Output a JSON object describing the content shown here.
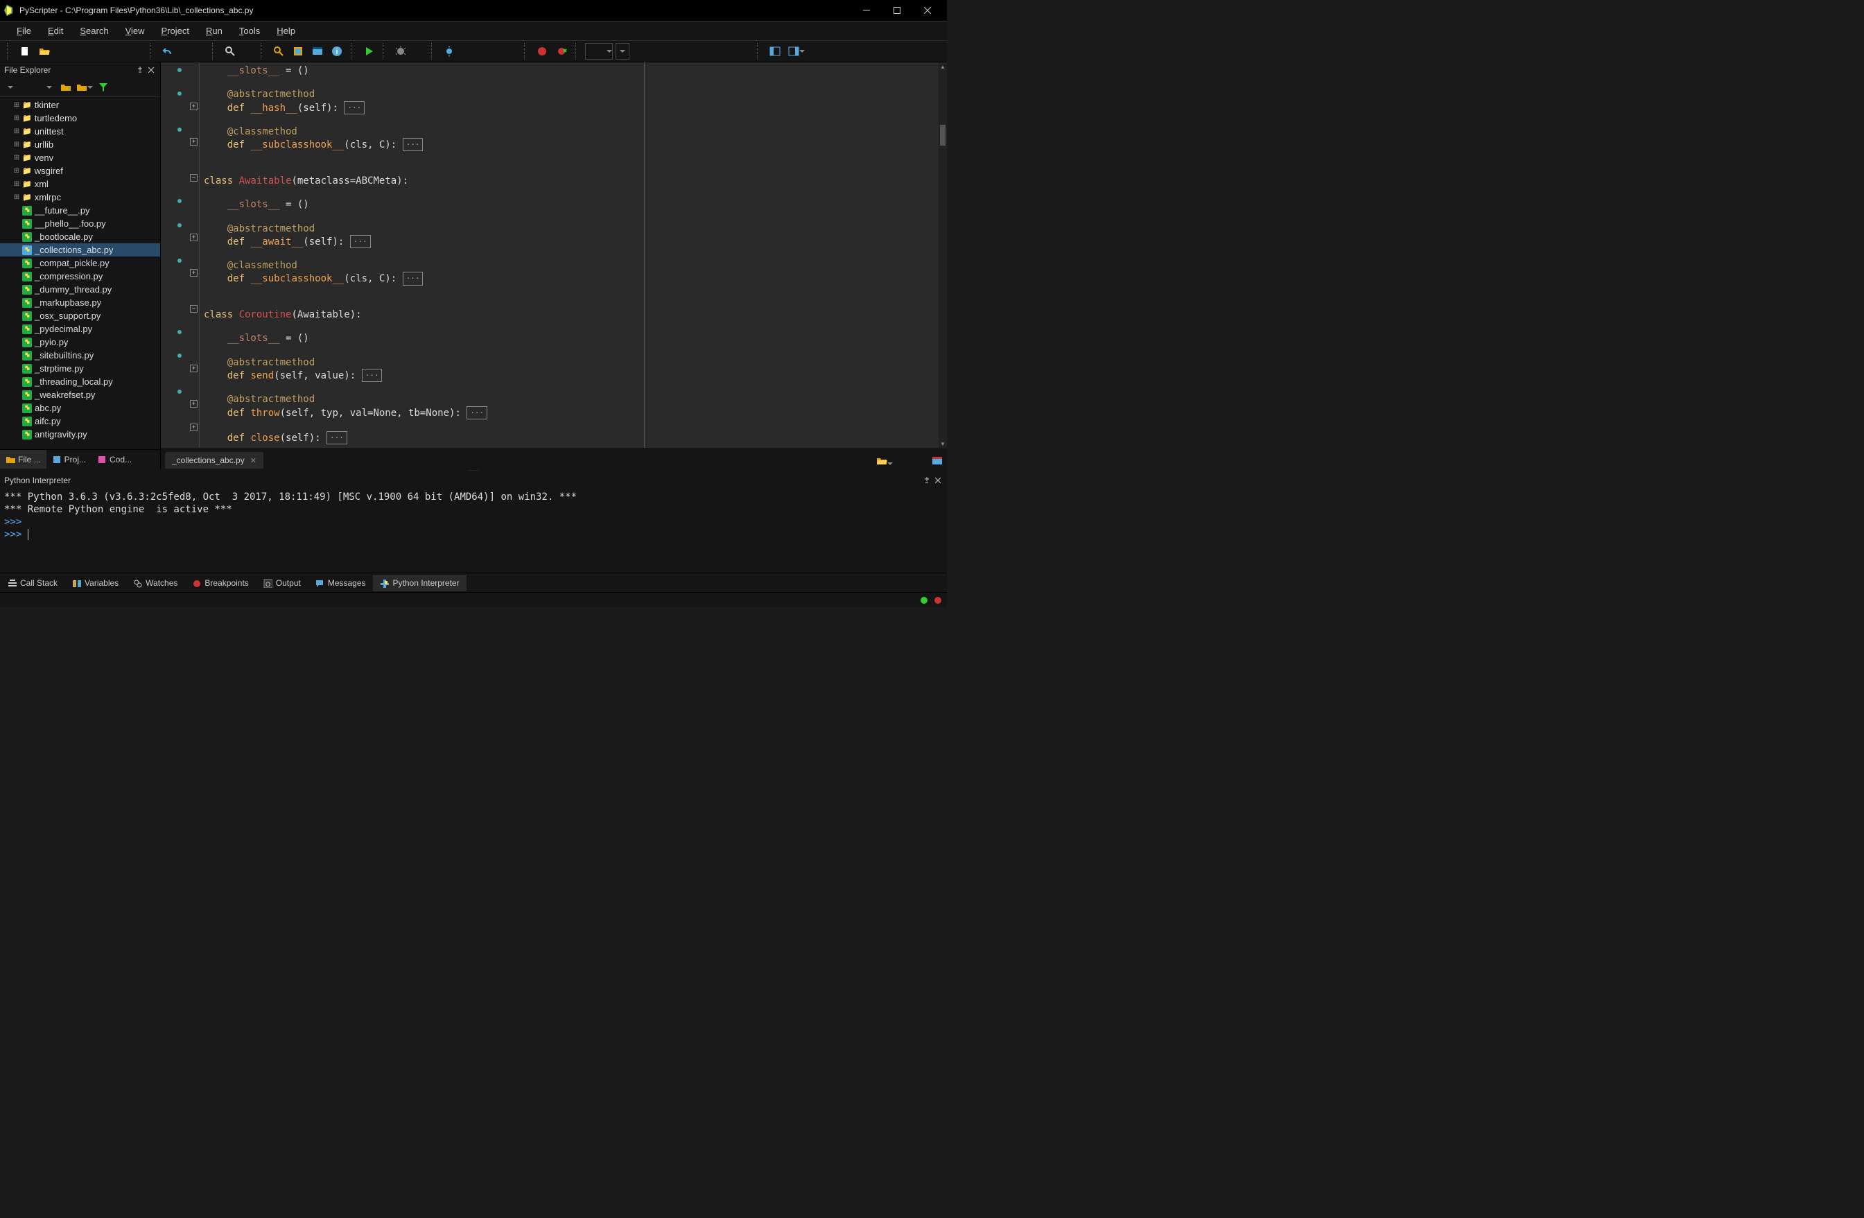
{
  "title": "PyScripter - C:\\Program Files\\Python36\\Lib\\_collections_abc.py",
  "menu": [
    "File",
    "Edit",
    "Search",
    "View",
    "Project",
    "Run",
    "Tools",
    "Help"
  ],
  "sidebar": {
    "title": "File Explorer",
    "folders": [
      "tkinter",
      "turtledemo",
      "unittest",
      "urllib",
      "venv",
      "wsgiref",
      "xml",
      "xmlrpc"
    ],
    "files": [
      "__future__.py",
      "__phello__.foo.py",
      "_bootlocale.py",
      "_collections_abc.py",
      "_compat_pickle.py",
      "_compression.py",
      "_dummy_thread.py",
      "_markupbase.py",
      "_osx_support.py",
      "_pydecimal.py",
      "_pyio.py",
      "_sitebuiltins.py",
      "_strptime.py",
      "_threading_local.py",
      "_weakrefset.py",
      "abc.py",
      "aifc.py",
      "antigravity.py"
    ],
    "selected": "_collections_abc.py",
    "tabs": [
      "File ...",
      "Proj...",
      "Cod..."
    ]
  },
  "editor_tab": "_collections_abc.py",
  "code": {
    "l1a": "__slots__",
    "l1b": " = ()",
    "l2": "@abstractmethod",
    "l3a": "def ",
    "l3b": "__hash__",
    "l3c": "(self): ",
    "l4": "@classmethod",
    "l5a": "def ",
    "l5b": "__subclasshook__",
    "l5c": "(cls, C): ",
    "l6a": "class ",
    "l6b": "Awaitable",
    "l6c": "(metaclass=ABCMeta):",
    "l7a": "__slots__",
    "l7b": " = ()",
    "l8": "@abstractmethod",
    "l9a": "def ",
    "l9b": "__await__",
    "l9c": "(self): ",
    "l10": "@classmethod",
    "l11a": "def ",
    "l11b": "__subclasshook__",
    "l11c": "(cls, C): ",
    "l12a": "class ",
    "l12b": "Coroutine",
    "l12c": "(Awaitable):",
    "l13a": "__slots__",
    "l13b": " = ()",
    "l14": "@abstractmethod",
    "l15a": "def ",
    "l15b": "send",
    "l15c": "(self, value): ",
    "l16": "@abstractmethod",
    "l17a": "def ",
    "l17b": "throw",
    "l17c": "(self, typ, val=None, tb=None): ",
    "l18a": "def ",
    "l18b": "close",
    "l18c": "(self): ",
    "ellipsis": "···"
  },
  "interpreter": {
    "title": "Python Interpreter",
    "line1": "*** Python 3.6.3 (v3.6.3:2c5fed8, Oct  3 2017, 18:11:49) [MSC v.1900 64 bit (AMD64)] on win32. ***",
    "line2": "*** Remote Python engine  is active ***",
    "prompt": ">>>"
  },
  "bottom_tabs": [
    "Call Stack",
    "Variables",
    "Watches",
    "Breakpoints",
    "Output",
    "Messages",
    "Python Interpreter"
  ]
}
